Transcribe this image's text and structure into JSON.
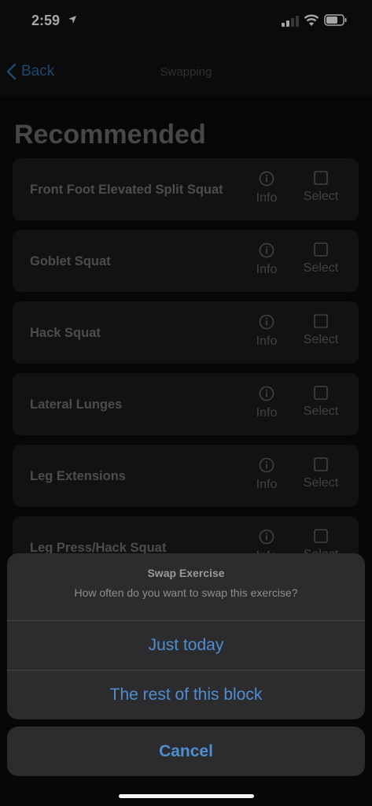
{
  "status_bar": {
    "time": "2:59",
    "location_icon": "location-arrow-icon",
    "signal_icon": "cell-signal-icon",
    "wifi_icon": "wifi-icon",
    "battery_icon": "battery-icon"
  },
  "nav": {
    "back_label": "Back",
    "title": "Swapping"
  },
  "section_title": "Recommended",
  "exercises": [
    {
      "name": "Front Foot Elevated Split Squat",
      "info_label": "Info",
      "select_label": "Select"
    },
    {
      "name": "Goblet Squat",
      "info_label": "Info",
      "select_label": "Select"
    },
    {
      "name": "Hack Squat",
      "info_label": "Info",
      "select_label": "Select"
    },
    {
      "name": "Lateral Lunges",
      "info_label": "Info",
      "select_label": "Select"
    },
    {
      "name": "Leg Extensions",
      "info_label": "Info",
      "select_label": "Select"
    },
    {
      "name": "Leg Press/Hack Squat",
      "info_label": "Info",
      "select_label": "Select"
    }
  ],
  "footer_ghost": {
    "info_label": "Info",
    "select_label": "Select"
  },
  "action_sheet": {
    "title": "Swap Exercise",
    "message": "How often do you want to swap this exercise?",
    "options": [
      "Just today",
      "The rest of this block"
    ],
    "cancel_label": "Cancel"
  },
  "colors": {
    "accent": "#4e8ed1",
    "back_link": "#2f6ea6",
    "sheet_bg": "#2c2c2e",
    "row_bg": "#1d1d1d"
  }
}
